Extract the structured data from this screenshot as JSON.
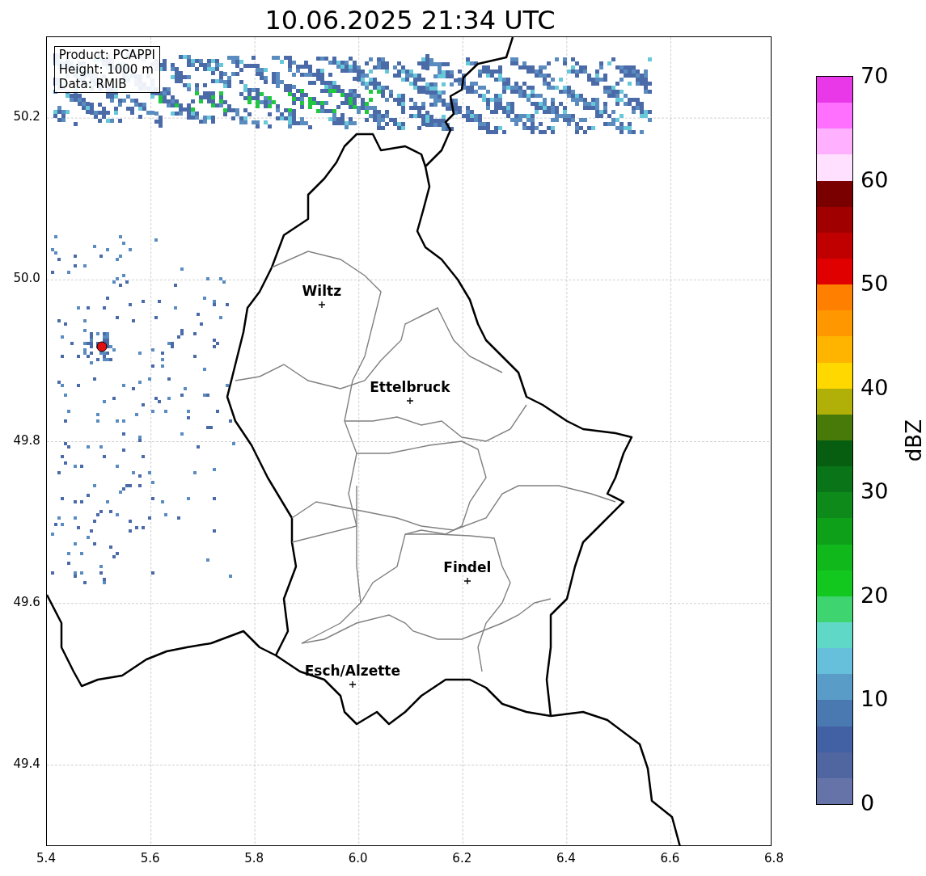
{
  "title": "10.06.2025 21:34 UTC",
  "info_box": [
    "Product: PCAPPI",
    "Height: 1000 m",
    "Data: RMIB"
  ],
  "cities": [
    "Wiltz",
    "Ettelbruck",
    "Findel",
    "Esch/Alzette"
  ],
  "x_ticks": [
    "5.4",
    "5.6",
    "5.8",
    "6.0",
    "6.2",
    "6.4",
    "6.6",
    "6.8"
  ],
  "y_ticks": [
    "50.2",
    "50.0",
    "49.8",
    "49.6",
    "49.4"
  ],
  "colorbar": {
    "label": "dBZ",
    "ticks": [
      "70",
      "60",
      "50",
      "40",
      "30",
      "20",
      "10",
      "0"
    ],
    "bands": [
      {
        "color": "#e838e8"
      },
      {
        "color": "#ff70ff"
      },
      {
        "color": "#ffb0ff"
      },
      {
        "color": "#ffe0ff"
      },
      {
        "color": "#7a0000"
      },
      {
        "color": "#a00000"
      },
      {
        "color": "#c00000"
      },
      {
        "color": "#e00000"
      },
      {
        "color": "#ff7f00"
      },
      {
        "color": "#ff9800"
      },
      {
        "color": "#ffb400"
      },
      {
        "color": "#ffd800"
      },
      {
        "color": "#b0b008"
      },
      {
        "color": "#487a0a"
      },
      {
        "color": "#075e10"
      },
      {
        "color": "#0a7418"
      },
      {
        "color": "#0e8a1a"
      },
      {
        "color": "#0fa01a"
      },
      {
        "color": "#10b81c"
      },
      {
        "color": "#12c81e"
      },
      {
        "color": "#3ed470"
      },
      {
        "color": "#60d8c8"
      },
      {
        "color": "#66c0dc"
      },
      {
        "color": "#5a9cc8"
      },
      {
        "color": "#4a78b0"
      },
      {
        "color": "#4260a4"
      },
      {
        "color": "#5066a0"
      },
      {
        "color": "#6673a8"
      }
    ]
  }
}
